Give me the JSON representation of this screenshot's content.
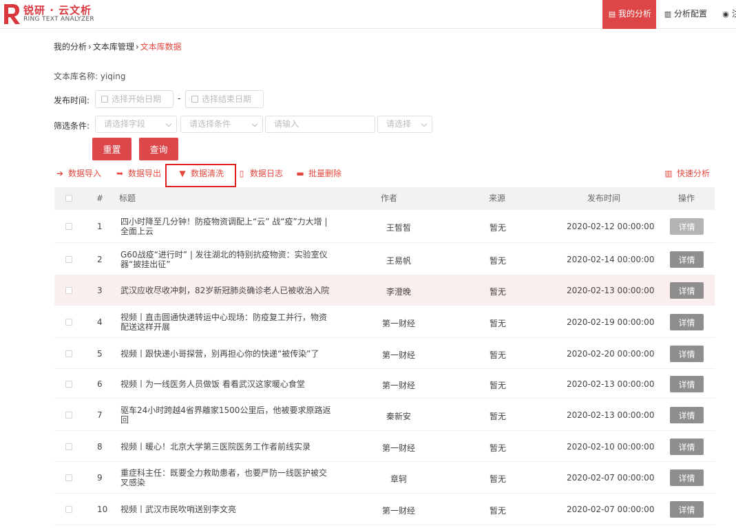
{
  "header": {
    "logo_title": "锐研 · 云文析",
    "logo_sub": "RING TEXT ANALYZER",
    "nav": [
      {
        "label": "我的分析",
        "icon": "document-icon"
      },
      {
        "label": "分析配置",
        "icon": "bar-chart-icon"
      },
      {
        "label": "注",
        "icon": "user-icon"
      }
    ],
    "brand_color": "#de4546"
  },
  "breadcrumb": [
    "我的分析",
    "文本库管理",
    "文本库数据"
  ],
  "form": {
    "lib_name_label": "文本库名称:",
    "lib_name_value": "yiqing",
    "publish_label": "发布时间:",
    "start_placeholder": "选择开始日期",
    "date_separator": "-",
    "end_placeholder": "选择结束日期",
    "filter_label": "筛选条件:",
    "field_placeholder": "请选择字段",
    "condition_placeholder": "请选择条件",
    "input_placeholder": "请输入",
    "select_placeholder": "请选择",
    "reset_label": "重置",
    "query_label": "查询"
  },
  "toolbar": {
    "import": "数据导入",
    "export": "数据导出",
    "clean": "数据清洗",
    "log": "数据日志",
    "batch_delete": "批量删除",
    "quick_analysis": "快速分析"
  },
  "table": {
    "headers": {
      "index": "#",
      "title": "标题",
      "author": "作者",
      "source": "来源",
      "time": "发布时间",
      "action": "操作"
    },
    "detail_label": "详情",
    "rows": [
      {
        "index": "1",
        "title": "四小时降至几分钟！防疫物资调配上“云” 战“疫”力大增 | 全面上云",
        "author": "王皙皙",
        "source": "暂无",
        "time": "2020-02-12 00:00:00"
      },
      {
        "index": "2",
        "title": "G60战疫“进行时” | 发往湖北的特别抗疫物资：实验室仪器“披挂出征”",
        "author": "王易帆",
        "source": "暂无",
        "time": "2020-02-14 00:00:00"
      },
      {
        "index": "3",
        "title": "武汉应收尽收冲刺，82岁新冠肺炎确诊老人已被收治入院",
        "author": "李澄晚",
        "source": "暂无",
        "time": "2020-02-13 00:00:00"
      },
      {
        "index": "4",
        "title": "视频丨直击圆通快递转运中心现场：防疫复工并行，物资配送这样开展",
        "author": "第一财经",
        "source": "暂无",
        "time": "2020-02-19 00:00:00"
      },
      {
        "index": "5",
        "title": "视频丨跟快递小哥探营，别再担心你的快递“被传染”了",
        "author": "第一财经",
        "source": "暂无",
        "time": "2020-02-20 00:00:00"
      },
      {
        "index": "6",
        "title": "视频丨为一线医务人员做饭 看看武汉这家暖心食堂",
        "author": "第一财经",
        "source": "暂无",
        "time": "2020-02-13 00:00:00"
      },
      {
        "index": "7",
        "title": "驱车24小时跨越4省界離家1500公里后，他被要求原路返回",
        "author": "秦新安",
        "source": "暂无",
        "time": "2020-02-13 00:00:00"
      },
      {
        "index": "8",
        "title": "视频丨暖心！北京大学第三医院医务工作者前线实录",
        "author": "第一财经",
        "source": "暂无",
        "time": "2020-02-10 00:00:00"
      },
      {
        "index": "9",
        "title": "重症科主任：既要全力救助患者，也要严防一线医护被交叉感染",
        "author": "章轲",
        "source": "暂无",
        "time": "2020-02-07 00:00:00"
      },
      {
        "index": "10",
        "title": "视频丨武汉市民吹哨送别李文亮",
        "author": "第一财经",
        "source": "暂无",
        "time": "2020-02-07 00:00:00"
      }
    ]
  }
}
